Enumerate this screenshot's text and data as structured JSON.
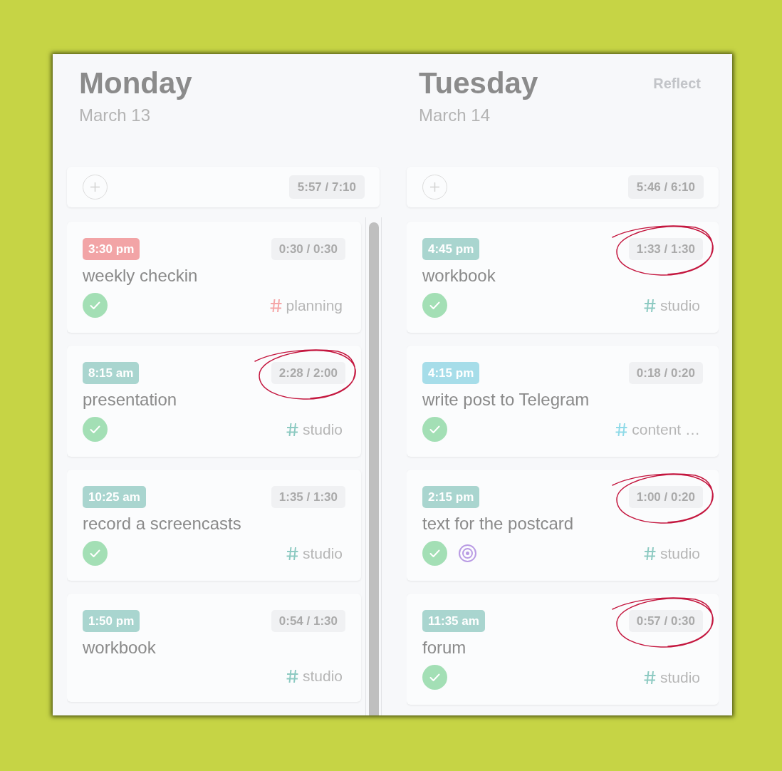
{
  "reflect_button": {
    "label": "Reflect",
    "disabled": true
  },
  "days": [
    {
      "weekday": "Monday",
      "date": "March 13",
      "totals": "5:57 / 7:10",
      "scrollable": true,
      "tasks": [
        {
          "time": "3:30 pm",
          "color": "#f2a4a6",
          "tracked": "0:30 / 0:30",
          "circled": false,
          "title": "weekly checkin",
          "done": true,
          "goal": false,
          "tag": {
            "label": "planning",
            "color": "#f5a6a7"
          }
        },
        {
          "time": "8:15 am",
          "color": "#a9d5cf",
          "tracked": "2:28 / 2:00",
          "circled": true,
          "title": "presentation",
          "done": true,
          "goal": false,
          "tag": {
            "label": "studio",
            "color": "#8dcac2"
          }
        },
        {
          "time": "10:25 am",
          "color": "#a9d5cf",
          "tracked": "1:35 / 1:30",
          "circled": false,
          "title": "record a screencasts",
          "done": true,
          "goal": false,
          "tag": {
            "label": "studio",
            "color": "#8dcac2"
          }
        },
        {
          "time": "1:50 pm",
          "color": "#a9d5cf",
          "tracked": "0:54 / 1:30",
          "circled": false,
          "title": "workbook",
          "done": false,
          "goal": false,
          "tag": {
            "label": "studio",
            "color": "#8dcac2"
          }
        }
      ]
    },
    {
      "weekday": "Tuesday",
      "date": "March 14",
      "totals": "5:46 / 6:10",
      "scrollable": false,
      "tasks": [
        {
          "time": "4:45 pm",
          "color": "#a9d5cf",
          "tracked": "1:33 / 1:30",
          "circled": true,
          "title": "workbook",
          "done": true,
          "goal": false,
          "tag": {
            "label": "studio",
            "color": "#8dcac2"
          }
        },
        {
          "time": "4:15 pm",
          "color": "#a6dde9",
          "tracked": "0:18 / 0:20",
          "circled": false,
          "title": "write post to Telegram",
          "done": true,
          "goal": false,
          "tag": {
            "label": "content …",
            "color": "#8fdae8"
          }
        },
        {
          "time": "2:15 pm",
          "color": "#a9d5cf",
          "tracked": "1:00 / 0:20",
          "circled": true,
          "title": "text for the postcard",
          "done": true,
          "goal": true,
          "tag": {
            "label": "studio",
            "color": "#8dcac2"
          }
        },
        {
          "time": "11:35 am",
          "color": "#a9d5cf",
          "tracked": "0:57 / 0:30",
          "circled": true,
          "title": "forum",
          "done": true,
          "goal": false,
          "tag": {
            "label": "studio",
            "color": "#8dcac2"
          }
        }
      ]
    }
  ]
}
